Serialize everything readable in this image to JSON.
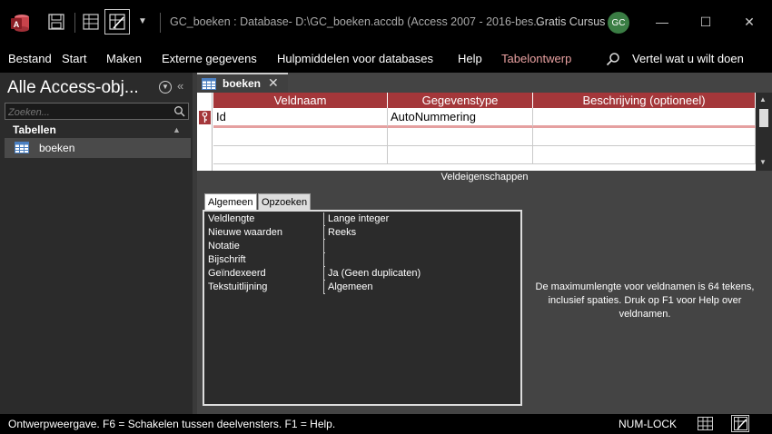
{
  "window": {
    "title": "GC_boeken : Database- D:\\GC_boeken.accdb (Access 2007 - 2016-bes...",
    "account_name": "Gratis Cursus",
    "avatar_initials": "GC",
    "controls": {
      "minimize": "—",
      "maximize": "☐",
      "close": "✕"
    }
  },
  "ribbon": {
    "tabs": [
      "Bestand",
      "Start",
      "Maken",
      "Externe gegevens",
      "Hulpmiddelen voor databases",
      "Help"
    ],
    "context_tab": "Tabelontwerp",
    "tell_me": "Vertel wat u wilt doen"
  },
  "nav_pane": {
    "title": "Alle Access-obj...",
    "search_placeholder": "Zoeken...",
    "group_label": "Tabellen",
    "items": [
      {
        "label": "boeken",
        "icon": "table-icon"
      }
    ]
  },
  "document": {
    "tab_label": "boeken",
    "grid": {
      "columns": [
        "Veldnaam",
        "Gegevenstype",
        "Beschrijving (optioneel)"
      ],
      "rows": [
        {
          "field": "Id",
          "type": "AutoNummering",
          "description": "",
          "primary_key": true
        }
      ]
    },
    "properties_title": "Veldeigenschappen",
    "property_tabs": [
      "Algemeen",
      "Opzoeken"
    ],
    "properties": [
      {
        "name": "Veldlengte",
        "value": "Lange integer"
      },
      {
        "name": "Nieuwe waarden",
        "value": "Reeks"
      },
      {
        "name": "Notatie",
        "value": ""
      },
      {
        "name": "Bijschrift",
        "value": ""
      },
      {
        "name": "Geïndexeerd",
        "value": "Ja (Geen duplicaten)"
      },
      {
        "name": "Tekstuitlijning",
        "value": "Algemeen"
      }
    ],
    "help_text": "De maximumlengte voor veldnamen is 64 tekens, inclusief spaties. Druk op F1 voor Help over veldnamen."
  },
  "statusbar": {
    "text": "Ontwerpweergave. F6 = Schakelen tussen deelvensters. F1 = Help.",
    "num_lock": "NUM-LOCK"
  },
  "colors": {
    "accent": "#a4373a",
    "background": "#1f1f1f",
    "context_tab": "#e8a0a0",
    "avatar": "#3a7d44"
  }
}
